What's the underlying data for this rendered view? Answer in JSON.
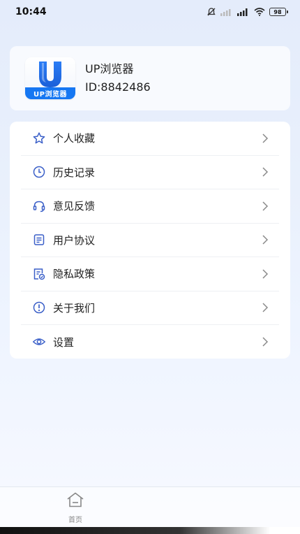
{
  "status_bar": {
    "time": "10:44",
    "battery": "98"
  },
  "profile": {
    "app_logo_letter": "U",
    "app_logo_text": "UP浏览器",
    "name": "UP浏览器",
    "id_text": "ID:8842486"
  },
  "menu": {
    "items": [
      {
        "label": "个人收藏",
        "icon": "star-icon"
      },
      {
        "label": "历史记录",
        "icon": "clock-icon"
      },
      {
        "label": "意见反馈",
        "icon": "headset-icon"
      },
      {
        "label": "用户协议",
        "icon": "document-icon"
      },
      {
        "label": "隐私政策",
        "icon": "privacy-icon"
      },
      {
        "label": "关于我们",
        "icon": "info-icon"
      },
      {
        "label": "设置",
        "icon": "settings-icon"
      }
    ]
  },
  "bottom_nav": {
    "home_label": "首页"
  },
  "colors": {
    "accent": "#3a5fc8",
    "logo_blue": "#1677f2"
  }
}
